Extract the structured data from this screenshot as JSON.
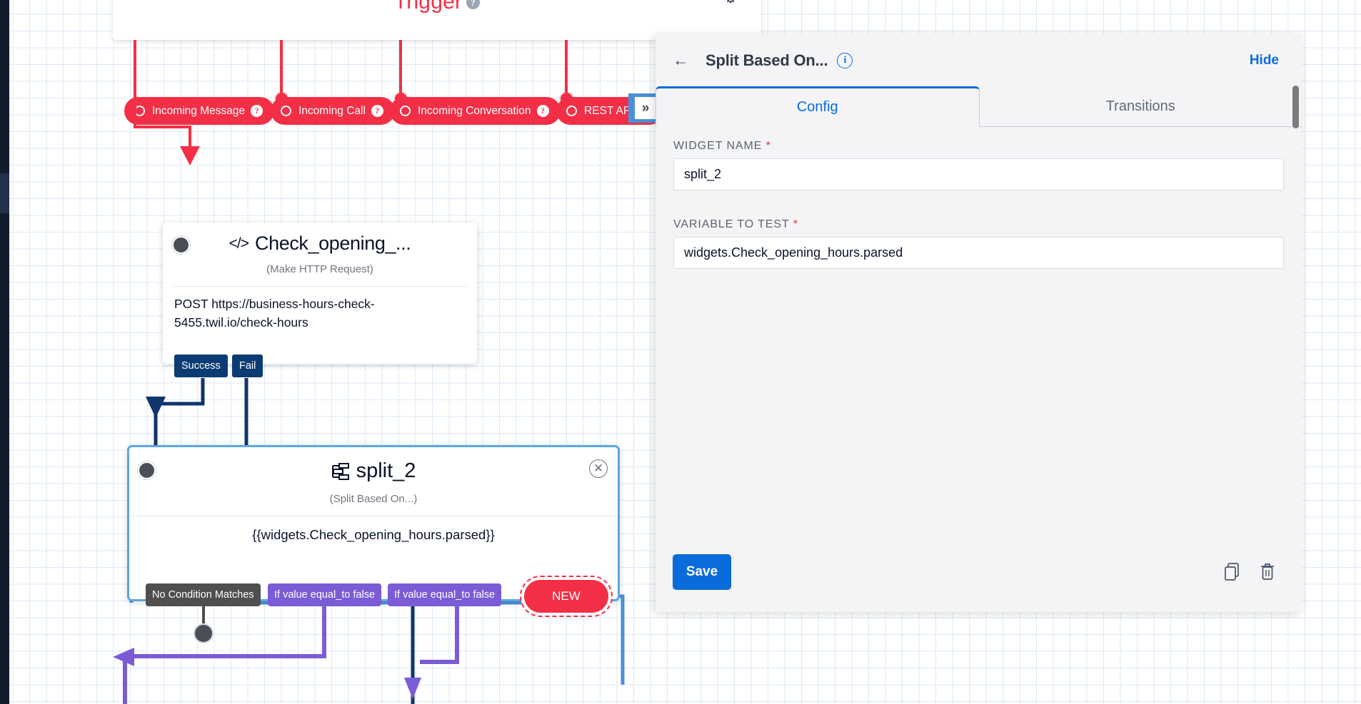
{
  "canvas": {
    "trigger": {
      "title": "Trigger",
      "help_icon": "question-mark-icon",
      "gear_icon": "gear-icon",
      "pills": [
        {
          "label": "Incoming Message",
          "help": "?"
        },
        {
          "label": "Incoming Call",
          "help": "?"
        },
        {
          "label": "Incoming Conversation",
          "help": "?"
        },
        {
          "label": "REST API",
          "help": "?"
        }
      ]
    },
    "http_node": {
      "title": "Check_opening_...",
      "type_icon": "code-icon",
      "subtitle": "(Make HTTP Request)",
      "body": "POST https://business-hours-check-5455.twil.io/check-hours",
      "exits": [
        "Success",
        "Fail"
      ]
    },
    "split_node": {
      "title": "split_2",
      "type_icon": "split-icon",
      "subtitle": "(Split Based On...)",
      "expression": "{{widgets.Check_opening_hours.parsed}}",
      "close_icon": "close-icon",
      "conditions": [
        {
          "label": "No Condition Matches",
          "style": "grey"
        },
        {
          "label": "If value equal_to false",
          "style": "purple"
        },
        {
          "label": "If value equal_to false",
          "style": "purple"
        }
      ],
      "new_pill": "NEW"
    },
    "colors": {
      "trigger_red": "#f22f46",
      "exit_navy": "#0b3b73",
      "condition_purple": "#7b5bd6",
      "condition_grey": "#4f4f4f",
      "selected_blue": "#5ba7e0",
      "wire_purple": "#7b5bd6"
    }
  },
  "panel": {
    "back_icon": "back-arrow-icon",
    "title": "Split Based On...",
    "info_icon": "info-icon",
    "hide_label": "Hide",
    "tabs": [
      {
        "label": "Config",
        "active": true
      },
      {
        "label": "Transitions",
        "active": false
      }
    ],
    "fields": [
      {
        "label": "WIDGET NAME",
        "required": "*",
        "value": "split_2"
      },
      {
        "label": "VARIABLE TO TEST",
        "required": "*",
        "value": "widgets.Check_opening_hours.parsed"
      }
    ],
    "footer": {
      "save_label": "Save",
      "copy_icon": "copy-icon",
      "delete_icon": "trash-icon"
    },
    "accent_color": "#0a6bdb"
  },
  "collapse_toggle": {
    "icon": "chevron-double-right-icon",
    "glyph": "»"
  }
}
